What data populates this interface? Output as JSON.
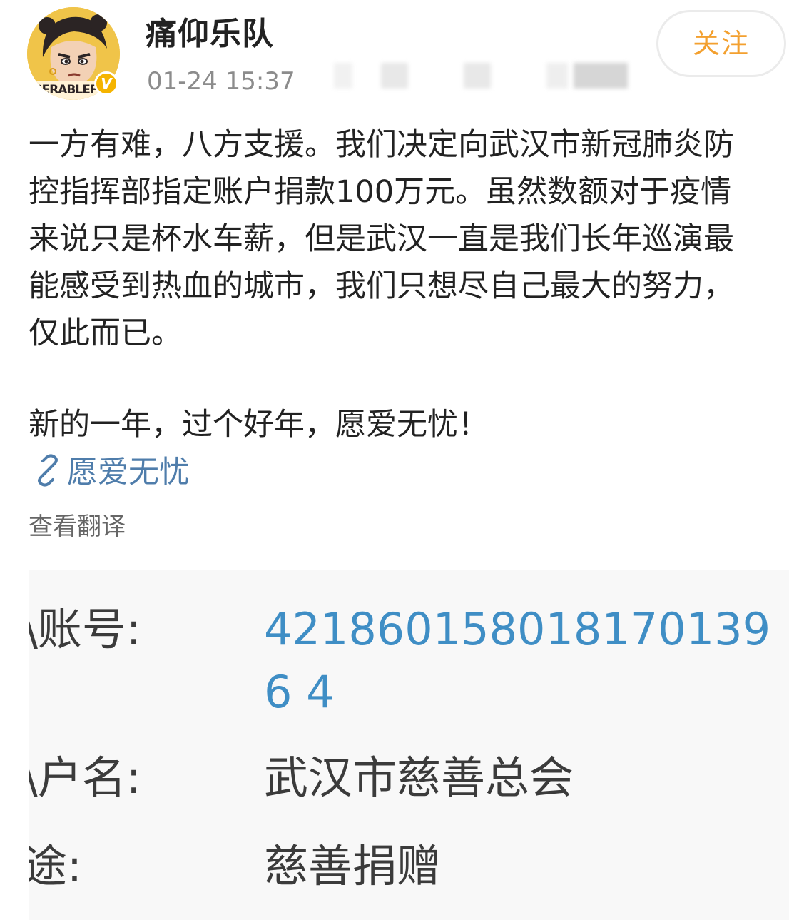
{
  "post": {
    "author": "痛仰乐队",
    "timestamp": "01-24 15:37",
    "follow_label": "关注",
    "avatar_caption": "ISERABLEF",
    "verified_mark": "V",
    "body_lines": [
      "一方有难，八方支援。我们决定向武汉市新冠肺炎防",
      "控指挥部指定账户捐款100万元。虽然数额对于疫情",
      "来说只是杯水车薪，但是武汉一直是我们长年巡演最",
      "能感受到热血的城市，我们只想尽自己最大的努力，",
      "仅此而已。"
    ],
    "closing_line": "新的一年，过个好年，愿爱无忧！",
    "topic_link": "愿爱无忧",
    "translate_label": "查看翻译"
  },
  "bank_info": {
    "account_label": "\\账号:",
    "account_number": "4218601580181701396 4",
    "name_label": "\\户名:",
    "name_value": "武汉市慈善总会",
    "purpose_label": "途:",
    "purpose_value": "慈善捐赠"
  },
  "icons": {
    "avatar": "cartoon-avatar-icon",
    "verified": "verified-badge-icon",
    "link": "link-chain-icon"
  },
  "colors": {
    "follow_accent": "#f3a02f",
    "link_blue": "#4f7dab",
    "account_blue": "#3f8ec5",
    "verified_gold": "#f5b400"
  }
}
